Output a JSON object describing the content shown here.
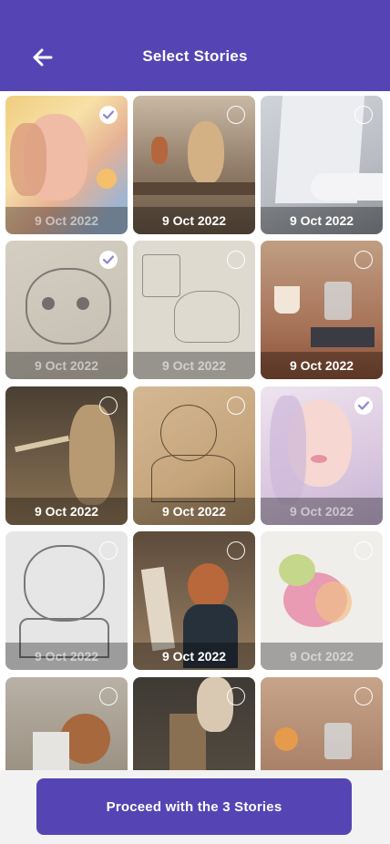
{
  "header": {
    "title": "Select Stories",
    "back_icon": "arrow-left-icon"
  },
  "stories": [
    {
      "date": "9 Oct 2022",
      "selected": true,
      "thumb": "painted-girl-face"
    },
    {
      "date": "9 Oct 2022",
      "selected": false,
      "thumb": "woman-desk"
    },
    {
      "date": "9 Oct 2022",
      "selected": false,
      "thumb": "hand-drawing"
    },
    {
      "date": "9 Oct 2022",
      "selected": true,
      "thumb": "cat-sketch"
    },
    {
      "date": "9 Oct 2022",
      "selected": false,
      "thumb": "cat-line-drawing"
    },
    {
      "date": "9 Oct 2022",
      "selected": false,
      "thumb": "paint-table"
    },
    {
      "date": "9 Oct 2022",
      "selected": false,
      "thumb": "brushes-hands"
    },
    {
      "date": "9 Oct 2022",
      "selected": false,
      "thumb": "girl-sketch"
    },
    {
      "date": "9 Oct 2022",
      "selected": true,
      "thumb": "watercolor-girl"
    },
    {
      "date": "9 Oct 2022",
      "selected": false,
      "thumb": "anime-girl"
    },
    {
      "date": "9 Oct 2022",
      "selected": false,
      "thumb": "woman-easel"
    },
    {
      "date": "9 Oct 2022",
      "selected": false,
      "thumb": "bird-watercolor"
    },
    {
      "date": "",
      "selected": false,
      "thumb": "artist-easel"
    },
    {
      "date": "",
      "selected": false,
      "thumb": "brushes-jar"
    },
    {
      "date": "",
      "selected": false,
      "thumb": "paint-table-2"
    }
  ],
  "footer": {
    "proceed_label": "Proceed with the 3 Stories"
  },
  "colors": {
    "accent": "#5545b4",
    "footer_bg": "#f2f2f3"
  }
}
